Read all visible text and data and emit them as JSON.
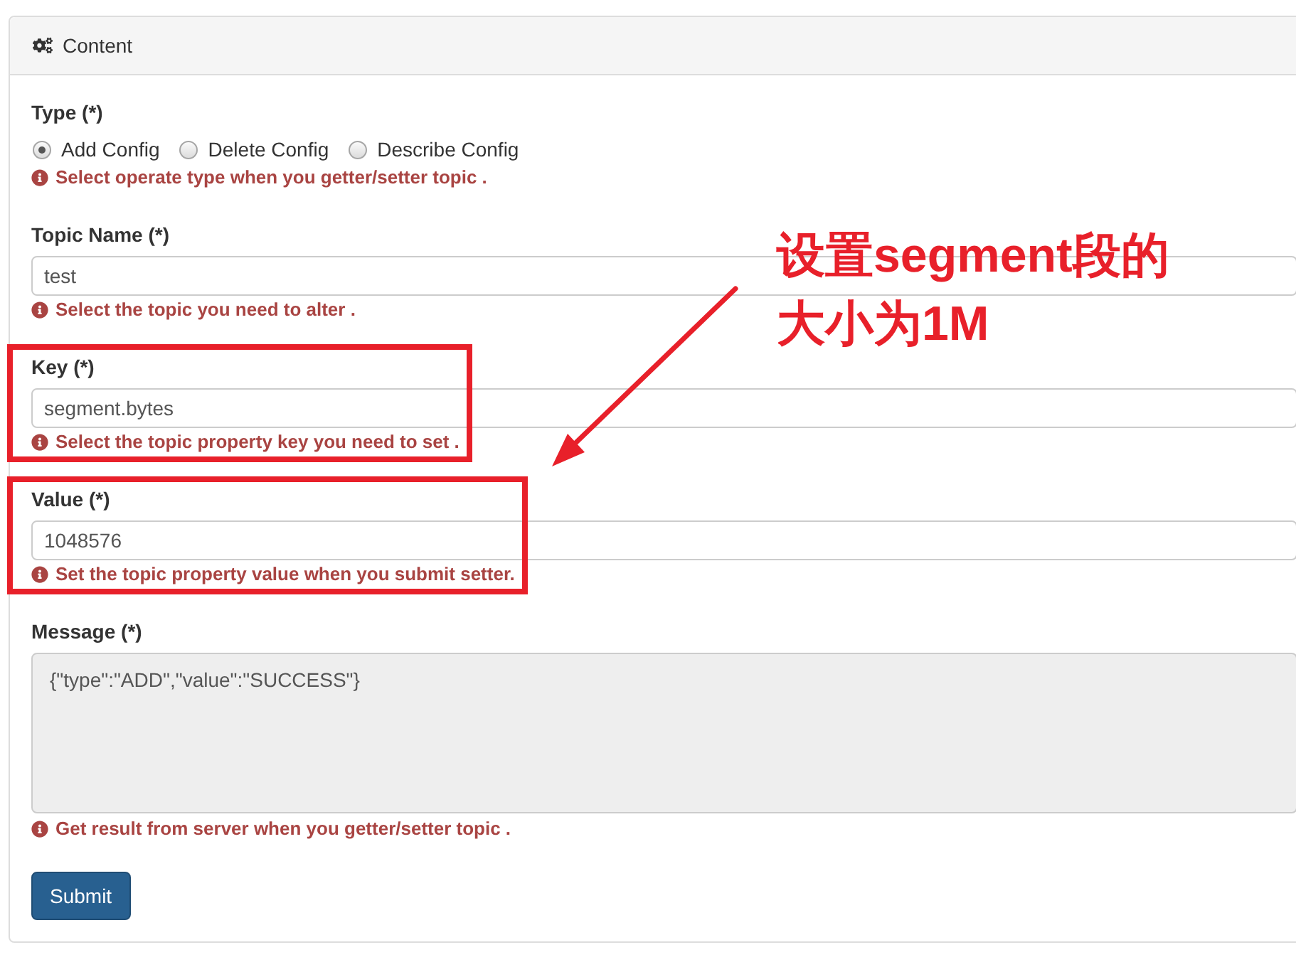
{
  "panel": {
    "title": "Content"
  },
  "type_group": {
    "label": "Type (*)",
    "options": [
      {
        "label": "Add Config",
        "selected": true
      },
      {
        "label": "Delete Config",
        "selected": false
      },
      {
        "label": "Describe Config",
        "selected": false
      }
    ],
    "help": "Select operate type when you getter/setter topic ."
  },
  "fields": [
    {
      "kind": "input",
      "label": "Topic Name (*)",
      "value": "test",
      "disabled": false,
      "highlighted": false,
      "help": "Select the topic you need to alter ."
    },
    {
      "kind": "input",
      "label": "Key (*)",
      "value": "segment.bytes",
      "disabled": false,
      "highlighted": true,
      "help": "Select the topic property key you need to set ."
    },
    {
      "kind": "input",
      "label": "Value (*)",
      "value": "1048576",
      "disabled": false,
      "highlighted": true,
      "help": "Set the topic property value when you submit setter."
    },
    {
      "kind": "textarea",
      "label": "Message (*)",
      "value": "{\"type\":\"ADD\",\"value\":\"SUCCESS\"}",
      "disabled": true,
      "highlighted": false,
      "help": "Get result from server when you getter/setter topic ."
    }
  ],
  "submit_button": {
    "label": "Submit"
  },
  "annotation": {
    "lines": [
      "设置segment段的",
      "大小为1M"
    ]
  }
}
